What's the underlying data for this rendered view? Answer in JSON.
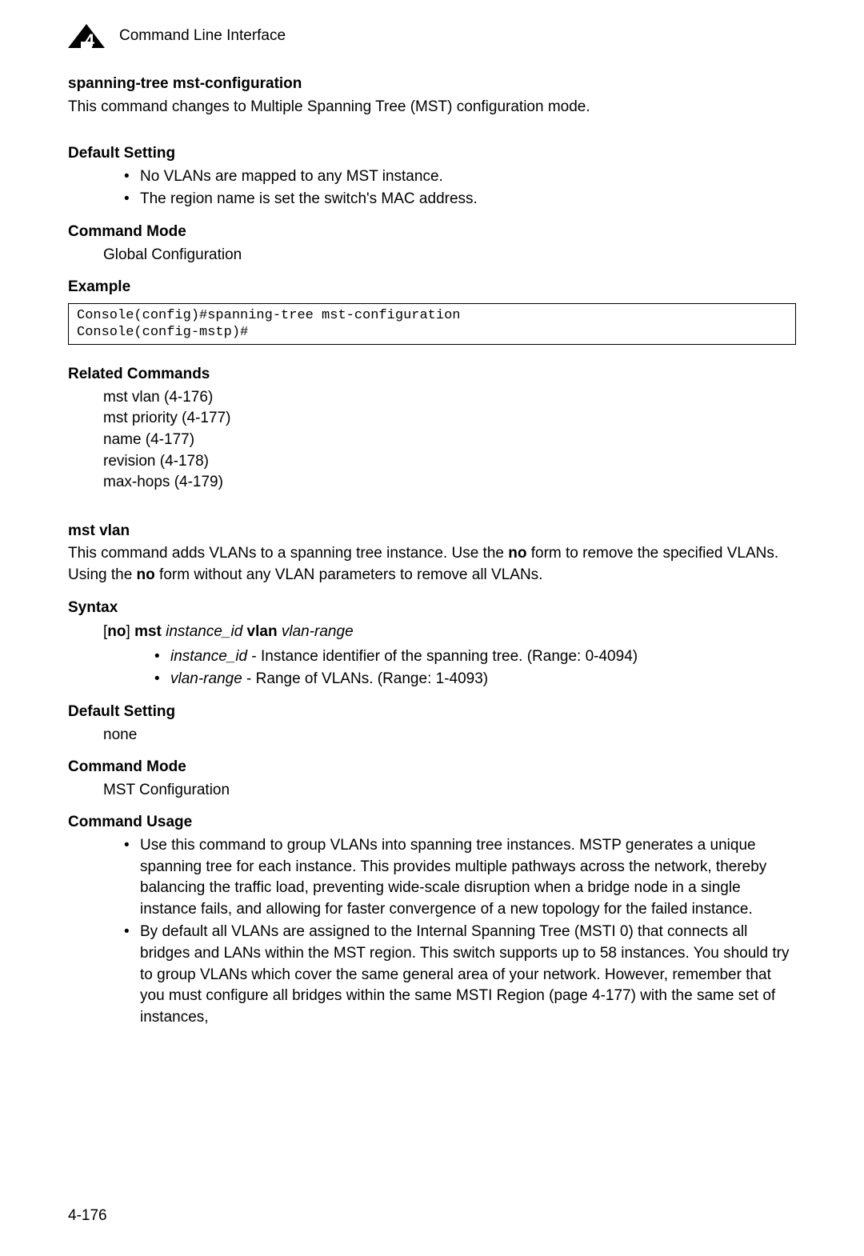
{
  "header": {
    "chapter_title": "Command Line Interface"
  },
  "section1": {
    "title": "spanning-tree mst-configuration",
    "desc": "This command changes to Multiple Spanning Tree (MST) configuration mode.",
    "default_setting_label": "Default Setting",
    "default_bullets": [
      "No VLANs are mapped to any MST instance.",
      "The region name is set the switch's MAC address."
    ],
    "command_mode_label": "Command Mode",
    "command_mode_value": "Global Configuration",
    "example_label": "Example",
    "example_code": "Console(config)#spanning-tree mst-configuration\nConsole(config-mstp)#",
    "related_label": "Related Commands",
    "related_items": [
      "mst vlan (4-176)",
      "mst priority (4-177)",
      "name (4-177)",
      "revision (4-178)",
      "max-hops (4-179)"
    ]
  },
  "section2": {
    "title": "mst vlan",
    "desc_pre": "This command adds VLANs to a spanning tree instance. Use the ",
    "desc_bold1": "no",
    "desc_mid1": " form to remove the specified VLANs. Using the ",
    "desc_bold2": "no",
    "desc_mid2": " form without any VLAN parameters to remove all VLANs.",
    "syntax_label": "Syntax",
    "syntax_brk_open": "[",
    "syntax_no": "no",
    "syntax_brk_close": "] ",
    "syntax_mst": "mst",
    "syntax_inst_id": " instance_id ",
    "syntax_vlan": "vlan",
    "syntax_range": " vlan-range",
    "syntax_bullets": [
      {
        "term": "instance_id",
        "dash": " - Instance identifier of the spanning tree. (Range: 0-4094)"
      },
      {
        "term": "vlan-range",
        "dash": " - Range of VLANs. (Range: 1-4093)"
      }
    ],
    "default_setting_label": "Default Setting",
    "default_setting_value": "none",
    "command_mode_label": "Command Mode",
    "command_mode_value": "MST Configuration",
    "usage_label": "Command Usage",
    "usage_bullets": [
      "Use this command to group VLANs into spanning tree instances. MSTP generates a unique spanning tree for each instance. This provides multiple pathways across the network, thereby balancing the traffic load, preventing wide-scale disruption when a bridge node in a single instance fails, and allowing for faster convergence of a new topology for the failed instance.",
      "By default all VLANs are assigned to the Internal Spanning Tree (MSTI 0) that connects all bridges and LANs within the MST region. This switch supports up to 58 instances. You should try to group VLANs which cover the same general area of your network. However, remember that you must configure all bridges within the same MSTI Region (page 4-177) with the same set of instances,"
    ]
  },
  "page_number": "4-176"
}
